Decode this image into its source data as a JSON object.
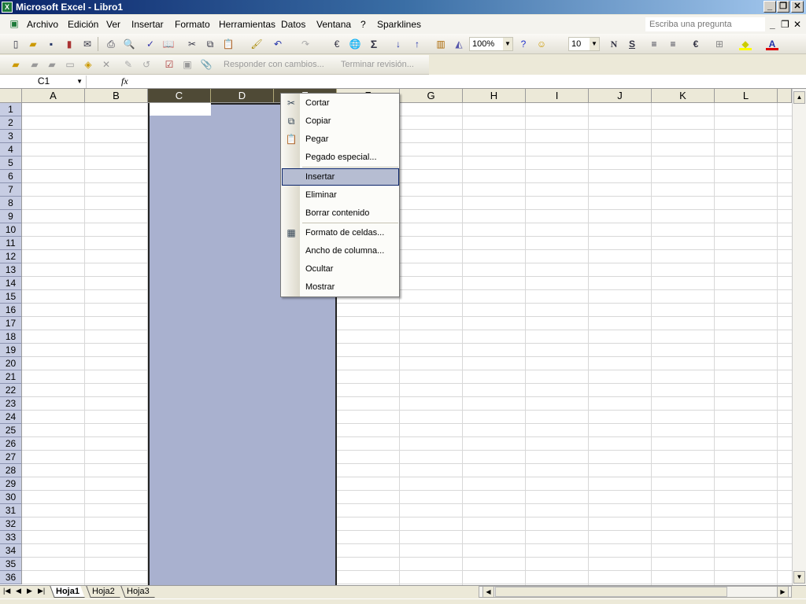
{
  "window": {
    "title": "Microsoft Excel - Libro1",
    "minimize": "_",
    "restore": "❐",
    "close": "✕"
  },
  "menubar": {
    "items": [
      "Archivo",
      "Edición",
      "Ver",
      "Insertar",
      "Formato",
      "Herramientas",
      "Datos",
      "Ventana",
      "?",
      "Sparklines"
    ],
    "ask_placeholder": "Escriba una pregunta",
    "doc_min": "_",
    "doc_restore": "❐",
    "doc_close": "✕"
  },
  "toolbar": {
    "zoom": "100%",
    "font_size": "10",
    "bold": "N",
    "underline": "S",
    "euro": "€",
    "sigma": "Σ",
    "review_reply": "Responder con cambios...",
    "review_end": "Terminar revisión..."
  },
  "formula_bar": {
    "name_box": "C1",
    "fx": "fx",
    "value": ""
  },
  "grid": {
    "columns": [
      "A",
      "B",
      "C",
      "D",
      "E",
      "F",
      "G",
      "H",
      "I",
      "J",
      "K",
      "L"
    ],
    "selected_columns": [
      "C",
      "D",
      "E"
    ],
    "rows": [
      "1",
      "2",
      "3",
      "4",
      "5",
      "6",
      "7",
      "8",
      "9",
      "10",
      "11",
      "12",
      "13",
      "14",
      "15",
      "16",
      "17",
      "18",
      "19",
      "20",
      "21",
      "22",
      "23",
      "24",
      "25",
      "26",
      "27",
      "28",
      "29",
      "30",
      "31",
      "32",
      "33",
      "34",
      "35",
      "36"
    ],
    "selection_color": "#a9b1cf"
  },
  "context_menu": {
    "items": [
      {
        "label": "Cortar",
        "icon": "scissors-icon",
        "glyph": "✂"
      },
      {
        "label": "Copiar",
        "icon": "copy-icon",
        "glyph": "⧉"
      },
      {
        "label": "Pegar",
        "icon": "paste-icon",
        "glyph": "📋"
      },
      {
        "label": "Pegado especial...",
        "icon": "",
        "glyph": ""
      },
      {
        "label": "Insertar",
        "icon": "",
        "glyph": "",
        "highlighted": true
      },
      {
        "label": "Eliminar",
        "icon": "",
        "glyph": ""
      },
      {
        "label": "Borrar contenido",
        "icon": "",
        "glyph": ""
      },
      {
        "label": "Formato de celdas...",
        "icon": "format-cells-icon",
        "glyph": "▦"
      },
      {
        "label": "Ancho de columna...",
        "icon": "",
        "glyph": ""
      },
      {
        "label": "Ocultar",
        "icon": "",
        "glyph": ""
      },
      {
        "label": "Mostrar",
        "icon": "",
        "glyph": ""
      }
    ]
  },
  "sheets": {
    "tabs": [
      "Hoja1",
      "Hoja2",
      "Hoja3"
    ],
    "active": "Hoja1"
  }
}
